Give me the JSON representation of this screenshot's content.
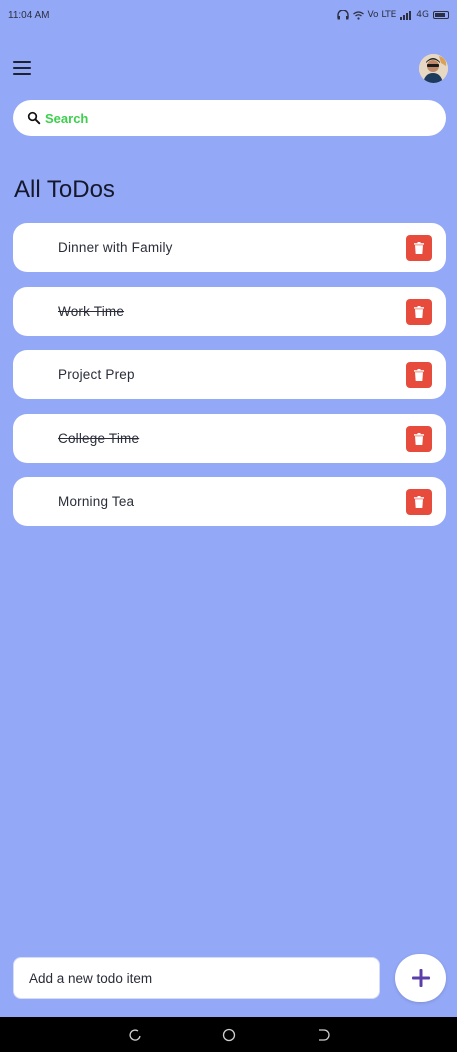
{
  "status_bar": {
    "time": "11:04 AM",
    "indicators": "Vo LTE",
    "network": "4G",
    "icons": [
      "headphones-icon",
      "wifi-icon",
      "signal-icon",
      "battery-icon"
    ]
  },
  "header": {
    "menu_icon": "menu-icon",
    "avatar_icon": "user-avatar"
  },
  "search": {
    "placeholder": "Search",
    "placeholder_color": "#3ecf4e"
  },
  "main": {
    "title": "All ToDos",
    "todos": [
      {
        "label": "Dinner with Family",
        "done": false
      },
      {
        "label": "Work Time",
        "done": true
      },
      {
        "label": "Project Prep",
        "done": false
      },
      {
        "label": "College Time",
        "done": true
      },
      {
        "label": "Morning Tea",
        "done": false
      }
    ]
  },
  "footer": {
    "input_placeholder": "Add a new todo item",
    "add_icon": "plus-icon"
  },
  "colors": {
    "background": "#93a8f7",
    "delete": "#e64b3c",
    "accent": "#5b3fa8"
  }
}
